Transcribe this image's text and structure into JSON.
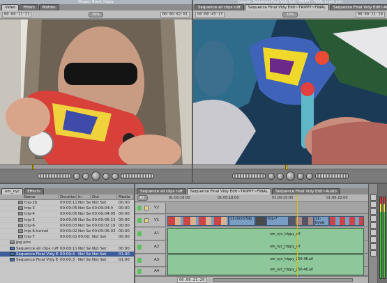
{
  "viewer": {
    "title": "Viewer: Brent_trippy",
    "tabs": [
      "Video",
      "Filters",
      "Motion"
    ],
    "duration_tc": "00:00:11:21",
    "zoom": "70%",
    "current_tc": "00:00:02:01"
  },
  "canvas": {
    "title": "Canvas: Sequence Final Vidy Edit~TRIPPY~FINAL in om_nyc",
    "tabs": [
      "Sequence all clips ruff",
      "Sequence Final Vidy Edit~TRIPPY~FINAL",
      "Sequence Final Vidy Edit~Audio"
    ],
    "duration_tc": "00:00:43:13",
    "zoom": "70%",
    "current_tc": "00:00:21:20"
  },
  "browser": {
    "tabs": [
      "om_nyc",
      "Effects"
    ],
    "columns": [
      "Name",
      "Duration",
      "In",
      "Out",
      "Media"
    ],
    "rows": [
      {
        "name": "trip-2b",
        "duration": "00:00:11:1",
        "in": "Not Set",
        "out": "Not Set",
        "media": "00:00",
        "type": "clip",
        "indent": 2
      },
      {
        "name": "trip-3",
        "duration": "00:00:05:1",
        "in": "Not Set",
        "out": "00:00:04:0",
        "media": "00:00",
        "type": "clip",
        "indent": 2
      },
      {
        "name": "trip-4",
        "duration": "00:00:05:0",
        "in": "Not Set",
        "out": "00:00:04:05",
        "media": "00:00",
        "type": "clip",
        "indent": 2
      },
      {
        "name": "trip-5",
        "duration": "00:00:05:1",
        "in": "Not Set",
        "out": "00:00:05:13",
        "media": "00:00",
        "type": "clip",
        "indent": 2
      },
      {
        "name": "trip-6",
        "duration": "00:00:03:1",
        "in": "Not Set",
        "out": "00:00:02:19",
        "media": "00:00",
        "type": "clip",
        "indent": 2
      },
      {
        "name": "trip-6-tunnel",
        "duration": "00:00:02:2",
        "in": "Not Set",
        "out": "00:00:06:03",
        "media": "00:00",
        "type": "clip",
        "indent": 2
      },
      {
        "name": "trip-7",
        "duration": "00:00:01:0",
        "in": "00:00:03:0",
        "out": "Not Set",
        "media": "00:00",
        "type": "clip",
        "indent": 2
      },
      {
        "name": "jpg pics",
        "duration": "",
        "in": "",
        "out": "",
        "media": "",
        "type": "bin",
        "indent": 1
      },
      {
        "name": "Sequence all clips ruff",
        "duration": "00:00:11:1",
        "in": "Not Set",
        "out": "Not Set",
        "media": "00:00",
        "type": "seq",
        "indent": 1
      },
      {
        "name": "Sequence Final Vidy Edit",
        "duration": "00:00:4",
        "in": "Not Set",
        "out": "Not Set",
        "media": "01:00",
        "type": "seq",
        "indent": 1,
        "selected": true
      },
      {
        "name": "Sequence Final Vidy Edit",
        "duration": "00:00:3",
        "in": "Not Set",
        "out": "Not Set",
        "media": "01:00",
        "type": "seq",
        "indent": 1
      }
    ]
  },
  "timeline": {
    "tabs": [
      "Sequence all clips ruff",
      "Sequence Final Vidy Edit~TRIPPY~FINAL",
      "Sequence Final Vidy Edit~Audio"
    ],
    "rt_label": "RT",
    "ruler": [
      "01:00:16:00",
      "01:00:18:00",
      "01:00:20:00",
      "01:00:22:00"
    ],
    "tracks": [
      "V2",
      "V1",
      "A1",
      "A2",
      "A3",
      "A4"
    ],
    "video_clips": [
      "11-tilnrtr5lip",
      "trip-7",
      "11-tilnrtr"
    ],
    "audio_clips": [
      "om_nyc_trippy_aif",
      "om_nyc_trippy_250-48.aif",
      "om_nyc_trippy_250-48.aif"
    ],
    "current_tc": "00:00:21:20"
  },
  "colors": {
    "accent_selection": "#3e5c9a",
    "video_clip": "#7a9dc4",
    "audio_clip": "#8ec79a",
    "playhead": "#ffde00"
  }
}
